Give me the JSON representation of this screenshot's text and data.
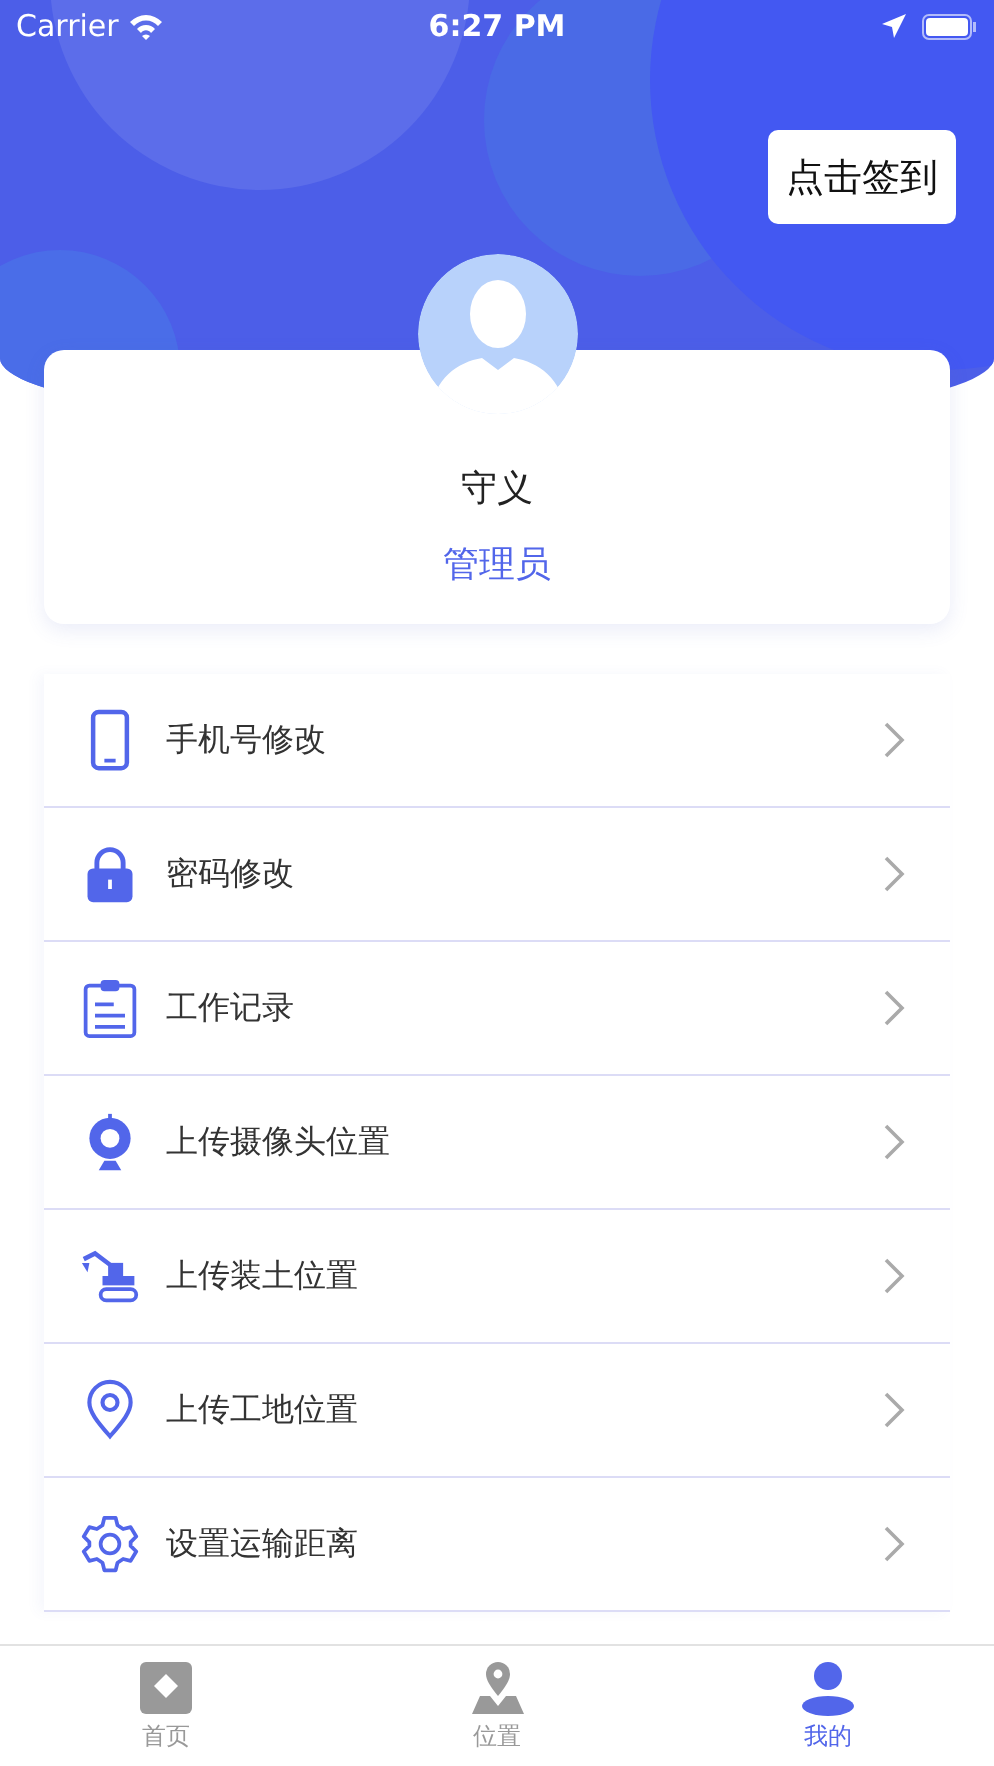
{
  "status_bar": {
    "carrier": "Carrier",
    "time": "6:27 PM"
  },
  "sign_in_button": "点击签到",
  "profile": {
    "name": "守义",
    "role": "管理员"
  },
  "menu": [
    {
      "kind": "phone",
      "label": "手机号修改"
    },
    {
      "kind": "lock",
      "label": "密码修改"
    },
    {
      "kind": "clipboard",
      "label": "工作记录"
    },
    {
      "kind": "camera",
      "label": "上传摄像头位置"
    },
    {
      "kind": "excavator",
      "label": "上传装土位置"
    },
    {
      "kind": "pin",
      "label": "上传工地位置"
    },
    {
      "kind": "gear",
      "label": "设置运输距离"
    }
  ],
  "tabs": [
    {
      "kind": "home",
      "label": "首页",
      "selected": false
    },
    {
      "kind": "location",
      "label": "位置",
      "selected": false
    },
    {
      "kind": "profile",
      "label": "我的",
      "selected": true
    }
  ]
}
